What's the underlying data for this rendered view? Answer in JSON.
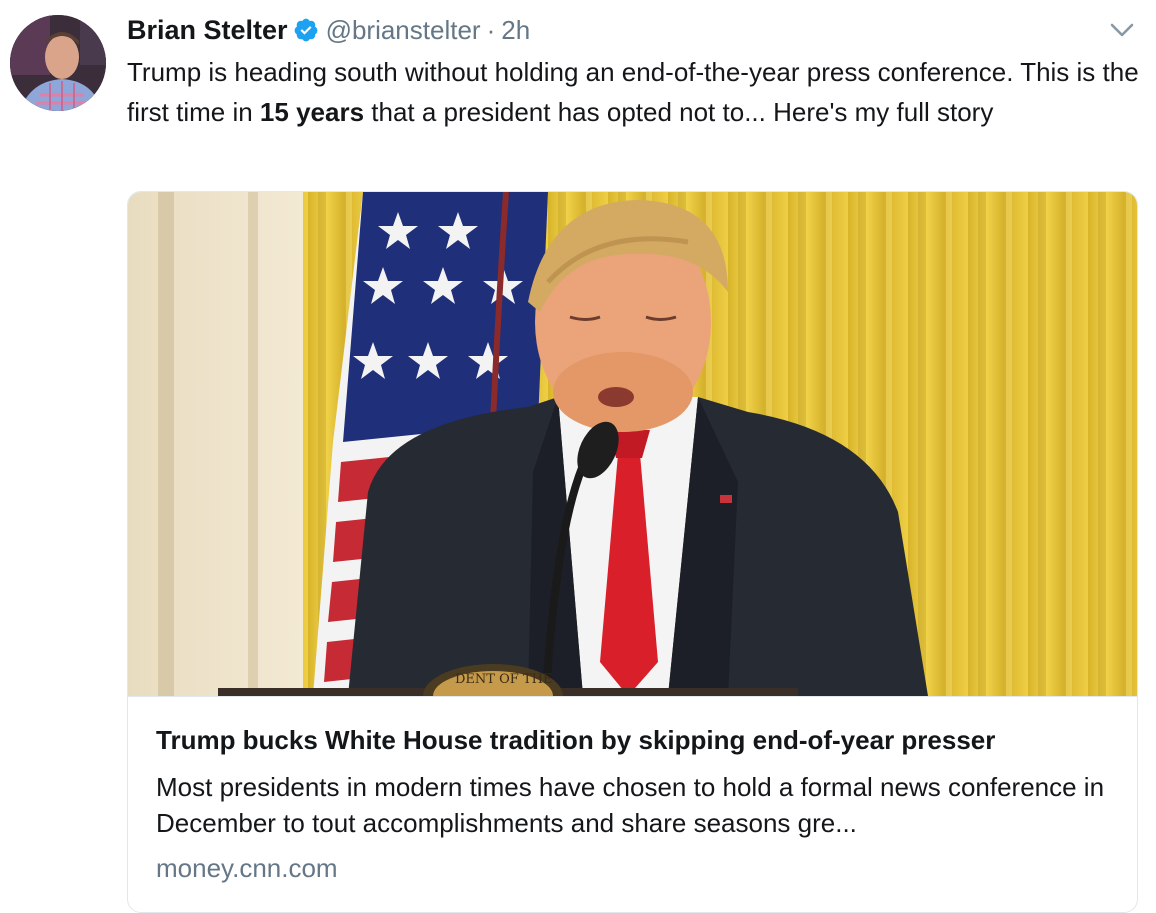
{
  "tweet": {
    "author": {
      "name": "Brian Stelter",
      "handle": "@brianstelter",
      "separator": "·",
      "time": "2h",
      "verified": true
    },
    "text": {
      "part1": "Trump is heading south without holding an end-of-the-year press conference. This is the first time in ",
      "bold": "15 years",
      "part2": " that a president has opted not to... Here's my full story"
    },
    "card": {
      "title": "Trump bucks White House tradition by skipping end-of-year presser",
      "description": "Most presidents in modern times have chosen to hold a formal news conference in December to tout accomplishments and share seasons gre...",
      "domain": "money.cnn.com",
      "image_seal_text": "DENT OF THE"
    },
    "icons": {
      "verified": "verified-badge-icon",
      "menu": "chevron-down-icon"
    },
    "colors": {
      "text": "#14171a",
      "secondary": "#657786",
      "verified": "#1da1f2",
      "border": "#e1e8ed"
    }
  }
}
